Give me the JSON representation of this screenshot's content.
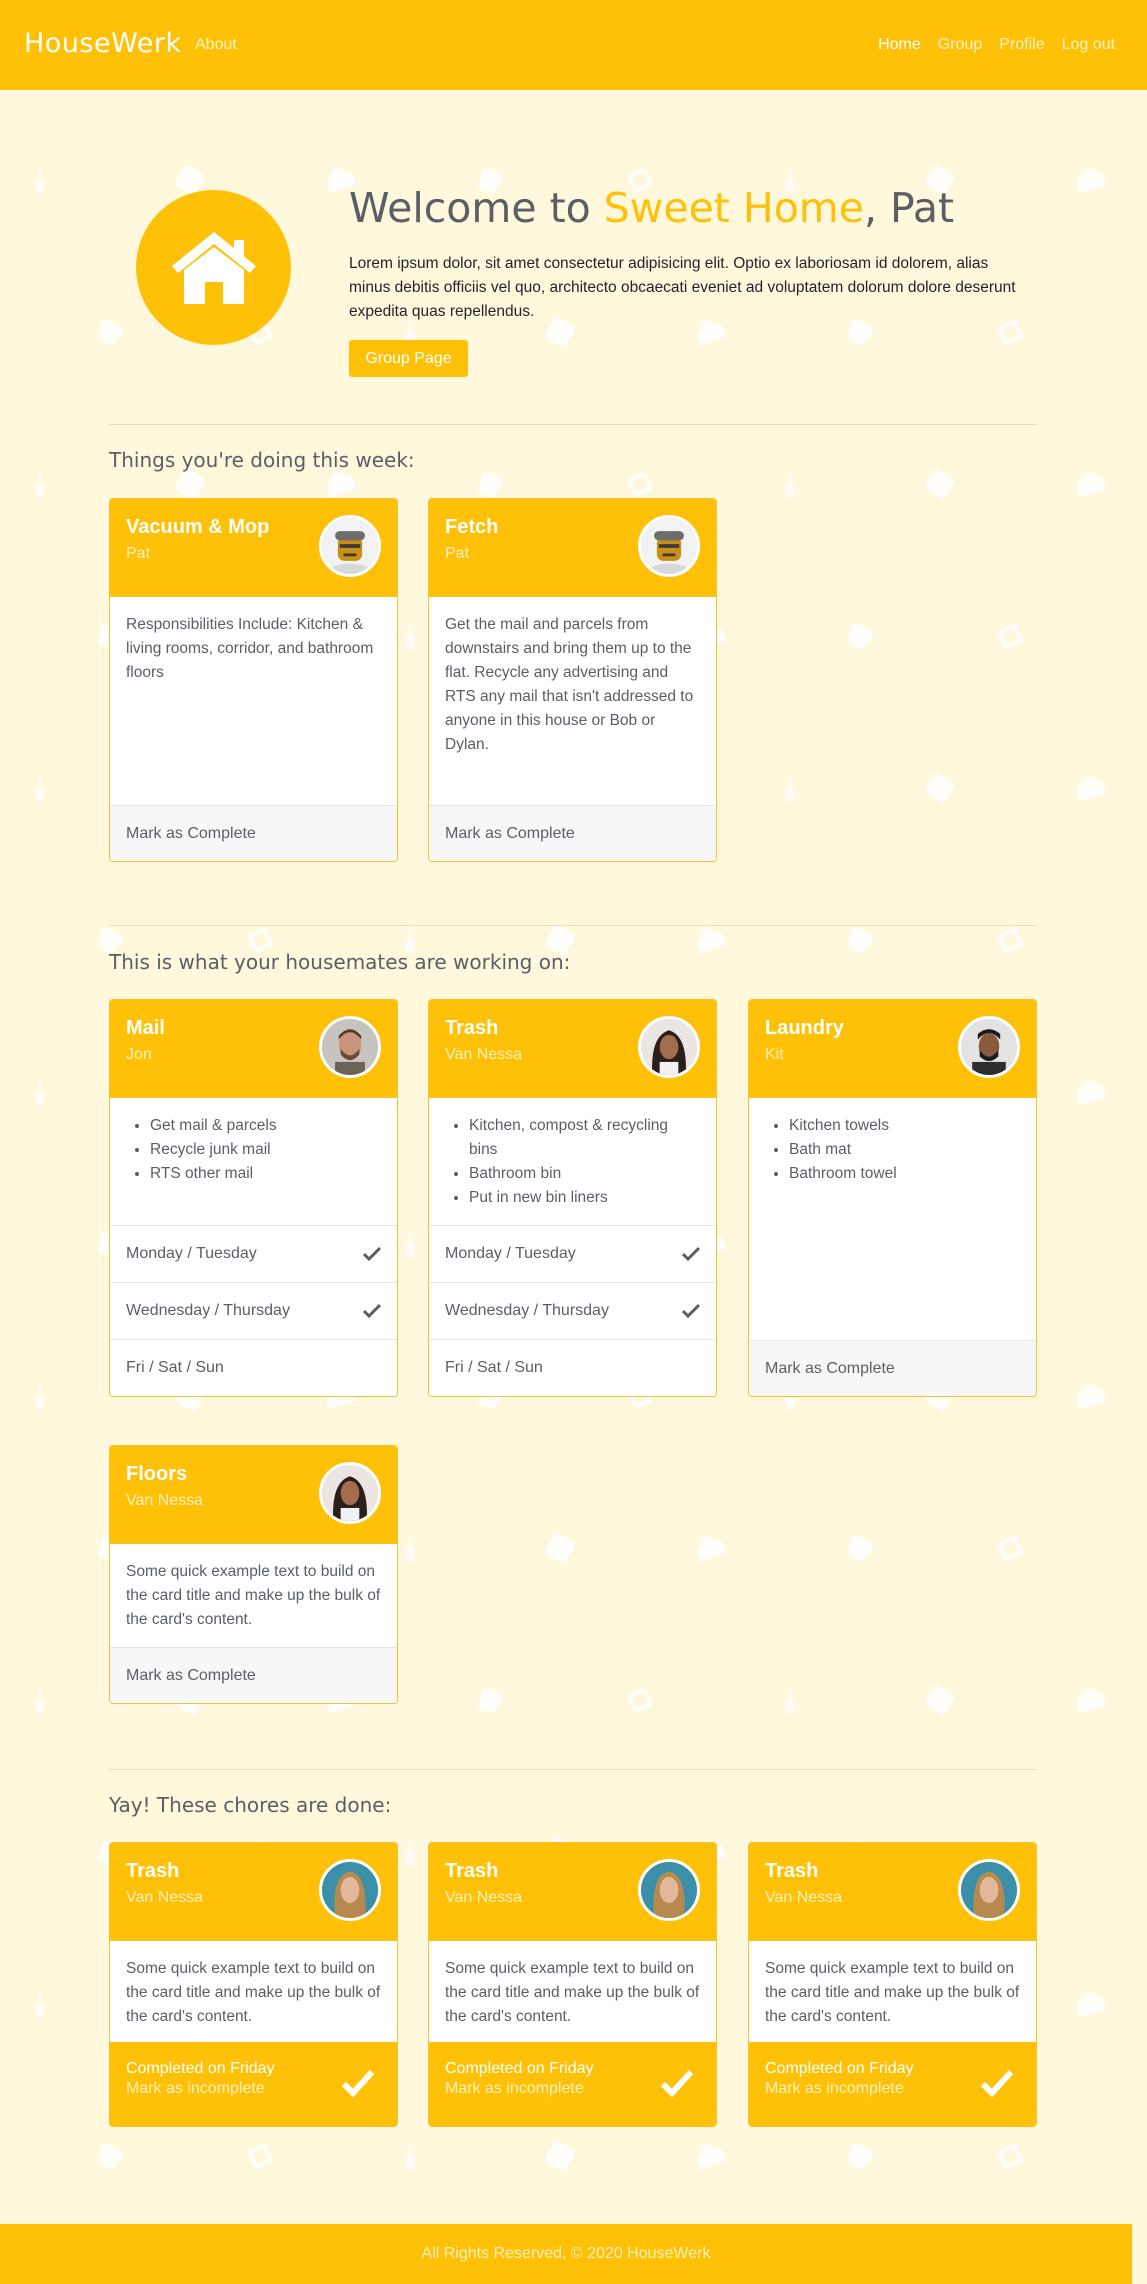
{
  "nav": {
    "brand": "HouseWerk",
    "about": "About",
    "links": [
      "Home",
      "Group",
      "Profile",
      "Log out"
    ]
  },
  "hero": {
    "title_prefix": "Welcome to ",
    "title_highlight": "Sweet Home",
    "title_suffix": ", Pat",
    "text": "Lorem ipsum dolor, sit amet consectetur adipisicing elit. Optio ex laboriosam id dolorem, alias minus debitis officiis vel quo, architecto obcaecati eveniet ad voluptatem dolorum dolore deserunt expedita quas repellendus.",
    "button": "Group Page",
    "logo_icon": "house-icon"
  },
  "sections": {
    "mine": "Things you're doing this week:",
    "housemates": "This is what your housemates are working on:",
    "done": "Yay! These chores are done:"
  },
  "my_chores": [
    {
      "title": "Vacuum & Mop",
      "person": "Pat",
      "body": "Responsibilities Include: Kitchen & living rooms, corridor, and bathroom floors",
      "action": "Mark as Complete"
    },
    {
      "title": "Fetch",
      "person": "Pat",
      "body": "Get the mail and parcels from downstairs and bring them up to the flat. Recycle any advertising and RTS any mail that isn't addressed to anyone in this house or Bob or Dylan.",
      "action": "Mark as Complete"
    }
  ],
  "housemate_chores": [
    {
      "title": "Mail",
      "person": "Jon",
      "items": [
        "Get mail & parcels",
        "Recycle junk mail",
        "RTS other mail"
      ],
      "days": [
        "Monday / Tuesday",
        "Wednesday / Thursday",
        "Fri / Sat / Sun"
      ]
    },
    {
      "title": "Trash",
      "person": "Van Nessa",
      "items": [
        "Kitchen, compost & recycling bins",
        "Bathroom bin",
        "Put in new bin liners"
      ],
      "days": [
        "Monday / Tuesday",
        "Wednesday / Thursday",
        "Fri / Sat / Sun"
      ]
    },
    {
      "title": "Laundry",
      "person": "Kit",
      "items": [
        "Kitchen towels",
        "Bath mat",
        "Bathroom towel"
      ],
      "action": "Mark as Complete"
    },
    {
      "title": "Floors",
      "person": "Van Nessa",
      "body": "Some quick example text to build on the card title and make up the bulk of the card's content.",
      "action": "Mark as Complete"
    }
  ],
  "done_chores": [
    {
      "title": "Trash",
      "person": "Van Nessa",
      "body": "Some quick example text to build on the card title and make up the bulk of the card's content.",
      "completed": "Completed on Friday",
      "undo": "Mark as incomplete"
    },
    {
      "title": "Trash",
      "person": "Van Nessa",
      "body": "Some quick example text to build on the card title and make up the bulk of the card's content.",
      "completed": "Completed on Friday",
      "undo": "Mark as incomplete"
    },
    {
      "title": "Trash",
      "person": "Van Nessa",
      "body": "Some quick example text to build on the card title and make up the bulk of the card's content.",
      "completed": "Completed on Friday",
      "undo": "Mark as incomplete"
    }
  ],
  "footer": "All Rights Reserved, © 2020 HouseWerk",
  "colors": {
    "accent": "#ffc107",
    "background": "#fff8dc"
  }
}
